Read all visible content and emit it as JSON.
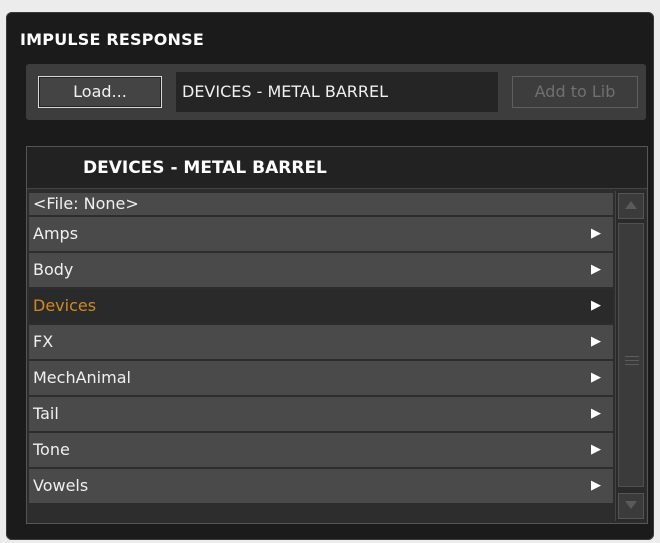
{
  "panel": {
    "title": "IMPULSE RESPONSE"
  },
  "toolbar": {
    "load_label": "Load...",
    "current_file": "DEVICES - METAL BARREL",
    "add_to_lib_label": "Add to Lib"
  },
  "browser": {
    "header": "DEVICES - METAL BARREL",
    "items": [
      {
        "label": "<File: None>",
        "has_arrow": false,
        "selected": false
      },
      {
        "label": "Amps",
        "has_arrow": true,
        "selected": false
      },
      {
        "label": "Body",
        "has_arrow": true,
        "selected": false
      },
      {
        "label": "Devices",
        "has_arrow": true,
        "selected": true
      },
      {
        "label": "FX",
        "has_arrow": true,
        "selected": false
      },
      {
        "label": "MechAnimal",
        "has_arrow": true,
        "selected": false
      },
      {
        "label": "Tail",
        "has_arrow": true,
        "selected": false
      },
      {
        "label": "Tone",
        "has_arrow": true,
        "selected": false
      },
      {
        "label": "Vowels",
        "has_arrow": true,
        "selected": false
      }
    ],
    "arrow_glyph": "▶"
  },
  "colors": {
    "selected_text": "#d28a1e",
    "panel_bg": "#1b1b1b"
  }
}
